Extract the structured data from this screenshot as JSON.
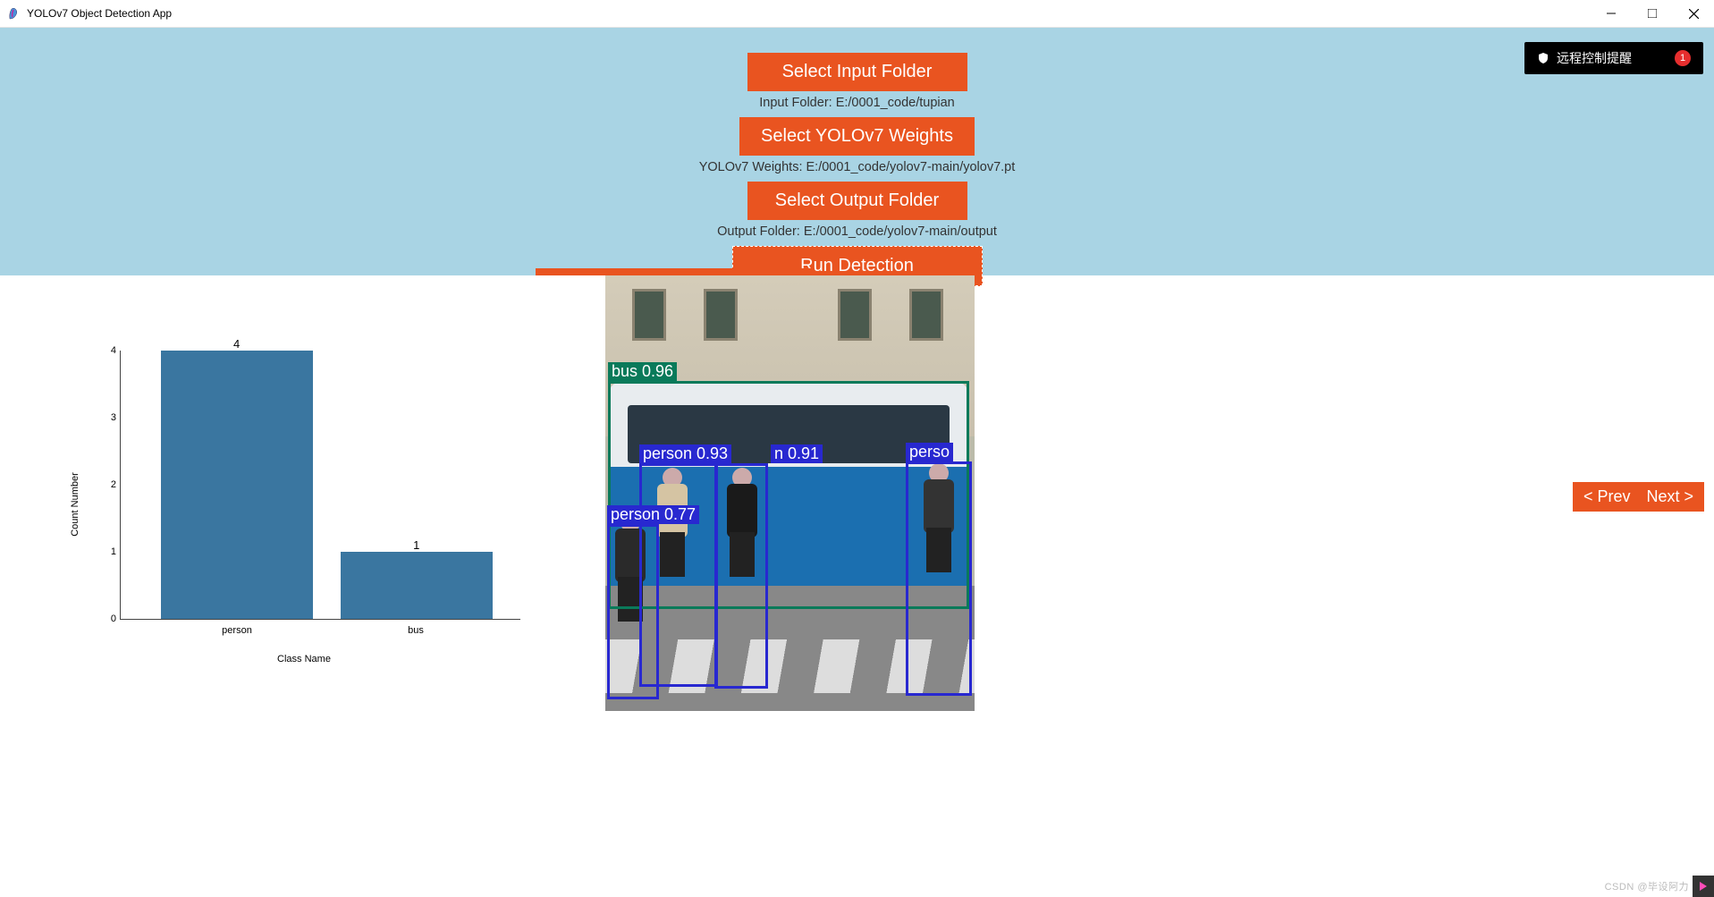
{
  "window": {
    "title": "YOLOv7 Object Detection App"
  },
  "buttons": {
    "select_input": "Select Input Folder",
    "select_weights": "Select YOLOv7 Weights",
    "select_output": "Select Output Folder",
    "run": "Run Detection",
    "prev": "< Prev",
    "next": "Next >"
  },
  "paths": {
    "input": "Input Folder: E:/0001_code/tupian",
    "weights": "YOLOv7 Weights: E:/0001_code/yolov7-main/yolov7.pt",
    "output": "Output Folder: E:/0001_code/yolov7-main/output"
  },
  "notification": {
    "text": "远程控制提醒",
    "badge": "1"
  },
  "detections": [
    {
      "class": "bus",
      "conf": "0.96",
      "label": "bus 0.96"
    },
    {
      "class": "person",
      "conf": "0.93",
      "label": "person 0.93"
    },
    {
      "class": "person",
      "conf": "0.91",
      "label": "n 0.91"
    },
    {
      "class": "person",
      "conf": "",
      "label": "perso"
    },
    {
      "class": "person",
      "conf": "0.77",
      "label": "person 0.77"
    }
  ],
  "watermark": "CSDN @毕设阿力",
  "chart_data": {
    "type": "bar",
    "title": "",
    "xlabel": "Class Name",
    "ylabel": "Count Number",
    "categories": [
      "person",
      "bus"
    ],
    "values": [
      4,
      1
    ],
    "ylim": [
      0,
      4
    ],
    "yticks": [
      0,
      1,
      2,
      3,
      4
    ],
    "bar_labels": [
      "4",
      "1"
    ]
  }
}
